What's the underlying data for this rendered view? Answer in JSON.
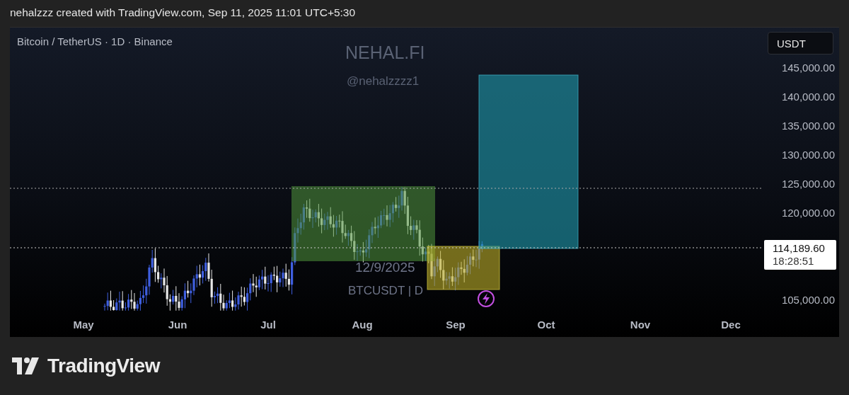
{
  "header": {
    "caption": "nehalzzz created with TradingView.com, Sep 11, 2025 11:01 UTC+5:30"
  },
  "chart": {
    "symbol_title": "Bitcoin / TetherUS · 1D · Binance",
    "watermark_brand": "NEHAL.FI",
    "watermark_handle": "@nehalzzzz1",
    "watermark_date": "12/9/2025",
    "watermark_symbol": "BTCUSDT | D",
    "currency_button": "USDT",
    "price_ticks": [
      "145,000.00",
      "140,000.00",
      "135,000.00",
      "130,000.00",
      "125,000.00",
      "120,000.00",
      "105,000.00"
    ],
    "time_ticks": [
      "May",
      "Jun",
      "Jul",
      "Aug",
      "Sep",
      "Oct",
      "Nov",
      "Dec"
    ],
    "last_price": {
      "price": "114,189.60",
      "countdown": "18:28:51"
    }
  },
  "footer": {
    "logo_text": "TradingView"
  }
}
